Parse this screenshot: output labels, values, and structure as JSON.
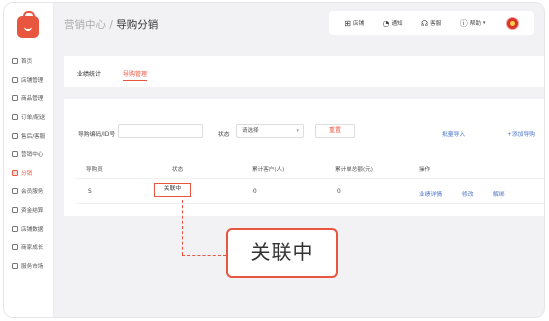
{
  "sidebar": {
    "items": [
      {
        "label": "首页"
      },
      {
        "label": "店铺管理"
      },
      {
        "label": "商品管理"
      },
      {
        "label": "订单/配送"
      },
      {
        "label": "售后/客服"
      },
      {
        "label": "营销中心"
      },
      {
        "label": "分销"
      },
      {
        "label": "会员服务"
      },
      {
        "label": "资金结算"
      },
      {
        "label": "店铺数据"
      },
      {
        "label": "商家成长"
      },
      {
        "label": "服务市场"
      }
    ],
    "active_index": 6
  },
  "header": {
    "breadcrumb_parent": "营销中心",
    "breadcrumb_sep": " / ",
    "breadcrumb_current": "导购分销",
    "topbar": {
      "a": "店铺",
      "b": "通知",
      "c": "客服",
      "d": "帮助"
    }
  },
  "tabs": [
    {
      "label": "业绩统计",
      "active": false
    },
    {
      "label": "导购管理",
      "active": true
    }
  ],
  "filters": {
    "id_label": "导购编码/ID号",
    "status_label": "状态",
    "status_value": "请选择",
    "reset_label": "重置",
    "import_label": "批量导入",
    "add_label": "+添加导购"
  },
  "table": {
    "headers": [
      "导购员",
      "状态",
      "累计客户(人)",
      "累计单总额(元)",
      "操作"
    ],
    "rows": [
      {
        "guide": "S",
        "status": "关联中",
        "customers": "0",
        "total": "0",
        "actions": [
          "业绩详情",
          "修改",
          "解绑"
        ]
      }
    ]
  },
  "callout": {
    "text": "关联中"
  },
  "colors": {
    "accent": "#e8563f",
    "link": "#4a73c9"
  }
}
